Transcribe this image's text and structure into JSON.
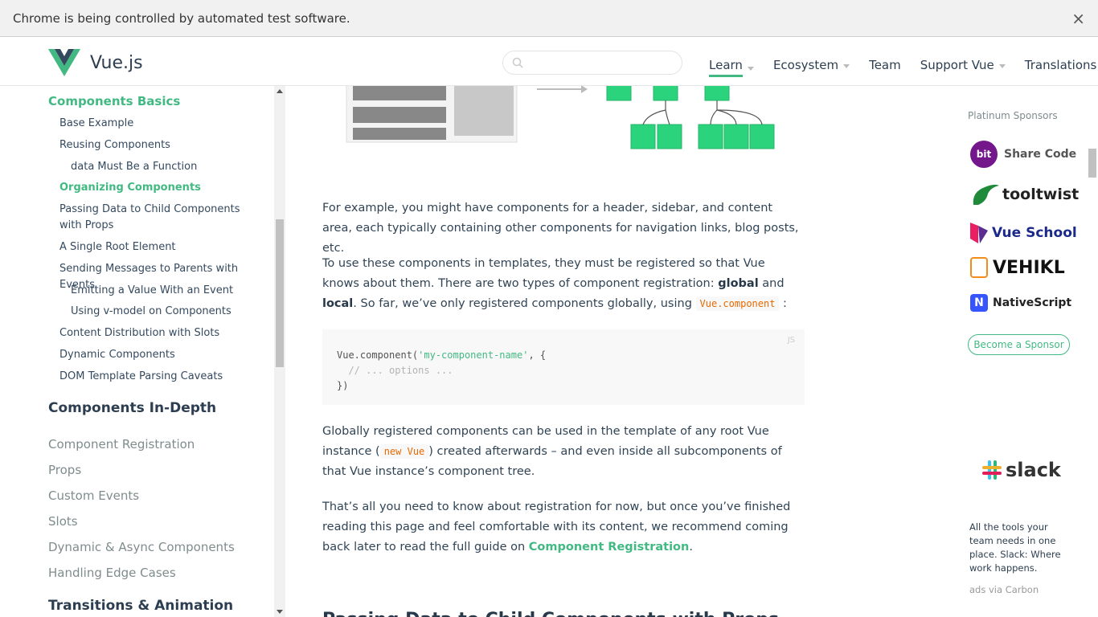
{
  "infobar": {
    "message": "Chrome is being controlled by automated test software.",
    "close": "×"
  },
  "header": {
    "brand": "Vue.js",
    "search_placeholder": "",
    "nav": [
      {
        "label": "Learn",
        "caret": true,
        "active": true
      },
      {
        "label": "Ecosystem",
        "caret": true
      },
      {
        "label": "Team",
        "caret": false
      },
      {
        "label": "Support Vue",
        "caret": true
      },
      {
        "label": "Translations",
        "caret": true
      }
    ]
  },
  "sidebar": {
    "section_current": "Components Basics",
    "sub_items": [
      "Base Example",
      "Reusing Components",
      "data Must Be a Function",
      "Organizing Components",
      "Passing Data to Child Components with Props",
      "A Single Root Element",
      "Sending Messages to Parents with Events",
      "Emitting a Value With an Event",
      "Using v-model on Components",
      "Content Distribution with Slots",
      "Dynamic Components",
      "DOM Template Parsing Caveats"
    ],
    "section_indepth": "Components In-Depth",
    "indepth_items": [
      "Component Registration",
      "Props",
      "Custom Events",
      "Slots",
      "Dynamic & Async Components",
      "Handling Edge Cases"
    ],
    "section_transitions": "Transitions & Animation"
  },
  "main": {
    "p1": "For example, you might have components for a header, sidebar, and content area, each typically containing other components for navigation links, blog posts, etc.",
    "p2_a": "To use these components in templates, they must be registered so that Vue knows about them. There are two types of component registration: ",
    "p2_global": "global",
    "p2_and": " and ",
    "p2_local": "local",
    "p2_b": ". So far, we’ve only registered components globally, using ",
    "p2_code": "Vue.component",
    "p2_c": ":",
    "code_lang": "JS",
    "code_line1_a": "Vue.component(",
    "code_line1_str": "'my-component-name'",
    "code_line1_b": ", {",
    "code_line2": "  // ... options ...",
    "code_line3": "})",
    "p3_a": "Globally registered components can be used in the template of any root Vue instance (",
    "p3_code": "new Vue",
    "p3_b": ") created afterwards – and even inside all subcomponents of that Vue instance’s component tree.",
    "p4_a": "That’s all you need to know about registration for now, but once you’ve finished reading this page and feel comfortable with its content, we recommend coming back later to read the full guide on ",
    "p4_link": "Component Registration",
    "p4_b": ".",
    "next_heading": "Passing Data to Child Components with Props"
  },
  "sponsors": {
    "title": "Platinum Sponsors",
    "items": [
      "bit Share Code",
      "tooltwist",
      "Vue School",
      "VEHIKL",
      "NativeScript"
    ],
    "become": "Become a Sponsor",
    "carbon_brand": "slack",
    "carbon_text": "All the tools your team needs in one place. Slack: Where work happens.",
    "carbon_via": "ads via Carbon"
  }
}
